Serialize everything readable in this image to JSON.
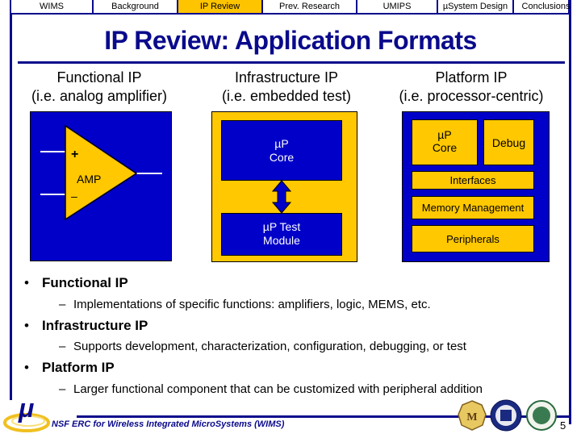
{
  "nav": {
    "tabs": [
      {
        "label": "WIMS",
        "active": false
      },
      {
        "label": "Background",
        "active": false
      },
      {
        "label": "IP Review",
        "active": true
      },
      {
        "label": "Prev. Research",
        "active": false
      },
      {
        "label": "UMIPS",
        "active": false
      },
      {
        "label": "µSystem Design",
        "active": false
      },
      {
        "label": "Conclusions",
        "active": false
      }
    ]
  },
  "slide": {
    "title": "IP Review: Application Formats",
    "columns": [
      {
        "heading": "Functional IP",
        "subheading": "(i.e. analog amplifier)"
      },
      {
        "heading": "Infrastructure IP",
        "subheading": "(i.e. embedded test)"
      },
      {
        "heading": "Platform IP",
        "subheading": "(i.e. processor-centric)"
      }
    ],
    "diagrams": {
      "functional": {
        "amp_label": "AMP",
        "plus": "+",
        "minus": "–"
      },
      "infrastructure": {
        "core_line1": "µP",
        "core_line2": "Core",
        "test_line1": "µP Test",
        "test_line2": "Module"
      },
      "platform": {
        "core_line1": "µP",
        "core_line2": "Core",
        "debug": "Debug",
        "interfaces": "Interfaces",
        "memory": "Memory Management",
        "peripherals": "Peripherals"
      }
    },
    "bullets": [
      {
        "label": "Functional IP",
        "sub": "Implementations of specific functions: amplifiers, logic, MEMS, etc."
      },
      {
        "label": "Infrastructure IP",
        "sub": "Supports development, characterization, configuration, debugging, or test"
      },
      {
        "label": "Platform IP",
        "sub": "Larger functional component that can be customized with peripheral addition"
      }
    ],
    "bullet_glyph": "•",
    "sub_glyph": "–"
  },
  "footer": {
    "text": "NSF ERC for Wireless Integrated MicroSystems (WIMS)",
    "logo_glyph": "μ",
    "page_number": "5",
    "seals": [
      "university-of-michigan-seal",
      "michigan-tech-seal",
      "michigan-state-seal"
    ]
  },
  "colors": {
    "navy": "#0a0a8c",
    "blue": "#0000c8",
    "yellow": "#ffc800",
    "active_tab": "#ffc400"
  }
}
